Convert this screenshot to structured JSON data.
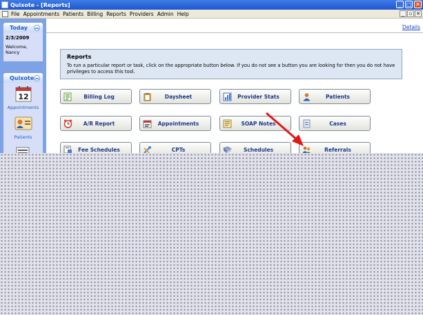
{
  "window": {
    "title": "Quixote - [Reports]"
  },
  "menu": {
    "items": [
      "File",
      "Appointments",
      "Patients",
      "Billing",
      "Reports",
      "Providers",
      "Admin",
      "Help"
    ]
  },
  "sidebar": {
    "today": {
      "title": "Today",
      "date": "2/3/2009",
      "welcome": "Welcome,\nNancy"
    },
    "quixote": {
      "title": "Quixote",
      "calendar_day": "12",
      "items": [
        {
          "label": "Appointments",
          "icon": "calendar-icon"
        },
        {
          "label": "Patients",
          "icon": "patient-card-icon"
        },
        {
          "label": "",
          "icon": "billing-icon"
        }
      ]
    }
  },
  "main": {
    "details_link": "Details",
    "reports": {
      "title": "Reports",
      "description": "To run a particular report or task, click on the appropriate button below.  If you do not see a button you are looking for then you do not have privileges to access this tool."
    },
    "buttons": [
      {
        "label": "Billing Log",
        "icon": "ledger-icon",
        "color": "#5a9e3a"
      },
      {
        "label": "Daysheet",
        "icon": "clipboard-icon",
        "color": "#e2a437"
      },
      {
        "label": "Provider Stats",
        "icon": "provider-icon",
        "color": "#3f6fbf"
      },
      {
        "label": "Patients",
        "icon": "person-icon",
        "color": "#c05a2a"
      },
      {
        "label": "A/R Report",
        "icon": "clock-icon",
        "color": "#d23a2a"
      },
      {
        "label": "Appointments",
        "icon": "calendar-icon",
        "color": "#c33b3b"
      },
      {
        "label": "SOAP Notes",
        "icon": "notes-icon",
        "color": "#e8d17a"
      },
      {
        "label": "Cases",
        "icon": "cases-icon",
        "color": "#7f8fb8"
      },
      {
        "label": "Fee Schedules",
        "icon": "fee-icon",
        "color": "#4f7cc8"
      },
      {
        "label": "CPTs",
        "icon": "tools-icon",
        "color": "#3a8ad0"
      },
      {
        "label": "Schedules",
        "icon": "book-icon",
        "color": "#6b7fb0"
      },
      {
        "label": "Referrals",
        "icon": "referrals-icon",
        "color": "#c4732f"
      }
    ]
  },
  "annotation": {
    "arrow_color": "#e01818"
  }
}
